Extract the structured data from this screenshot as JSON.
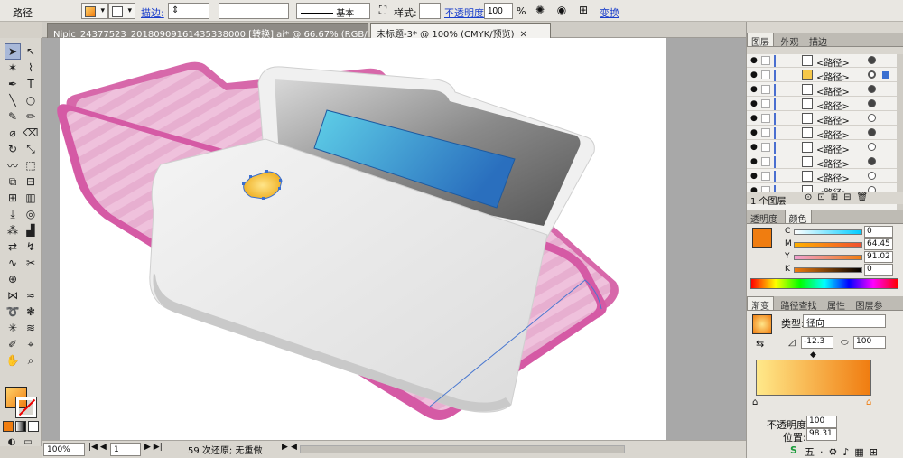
{
  "control_bar": {
    "selection_label": "路径",
    "stroke_link": "描边:",
    "stroke_style_label": "基本",
    "style_label": "样式:",
    "opacity_link": "不透明度",
    "opacity_value": "100",
    "opacity_unit": "%",
    "transform_link": "变换"
  },
  "doc_tabs": [
    {
      "label": "Nipic_24377523_20180909161435338000 [转换].ai* @ 66.67% (RGB/预览)",
      "close": "✕",
      "active": false
    },
    {
      "label": "未标题-3* @ 100% (CMYK/预览)",
      "close": "✕",
      "active": true
    }
  ],
  "status_bar": {
    "zoom": "100%",
    "page": "1",
    "message": "59 次还原; 无重做"
  },
  "panels": {
    "layers_tabs": [
      "图层",
      "外观",
      "描边"
    ],
    "layer_rows": [
      {
        "name": "<路径>",
        "target": "filled"
      },
      {
        "name": "<路径>",
        "target": "ring"
      },
      {
        "name": "<路径>",
        "target": "filled"
      },
      {
        "name": "<路径>",
        "target": "filled"
      },
      {
        "name": "<路径>",
        "target": "empty"
      },
      {
        "name": "<路径>",
        "target": "filled"
      },
      {
        "name": "<路径>",
        "target": "empty"
      },
      {
        "name": "<路径>",
        "target": "filled"
      },
      {
        "name": "<路径>",
        "target": "empty"
      },
      {
        "name": "<路径>",
        "target": "empty"
      }
    ],
    "layers_footer": "1 个图层",
    "color_tabs": [
      "透明度",
      "颜色"
    ],
    "cmyk": [
      {
        "channel": "C",
        "value": "0"
      },
      {
        "channel": "M",
        "value": "64.45"
      },
      {
        "channel": "Y",
        "value": "91.02"
      },
      {
        "channel": "K",
        "value": "0"
      }
    ],
    "gradient_tabs": [
      "渐变",
      "路径查找",
      "属性",
      "图层参"
    ],
    "gradient_type_label": "类型:",
    "gradient_type_value": "径向",
    "gradient_angle": "-12.3",
    "gradient_ratio": "100",
    "gradient_opacity_label": "不透明度:",
    "gradient_opacity_value": "100",
    "gradient_position_label": "位置:",
    "gradient_position_value": "98.31"
  },
  "colors": {
    "accent_orange": "#f07d10",
    "folder_pink": "#d95fa8",
    "screen_blue": "#2a7ec8",
    "clip_yellow": "#f6c84a"
  }
}
